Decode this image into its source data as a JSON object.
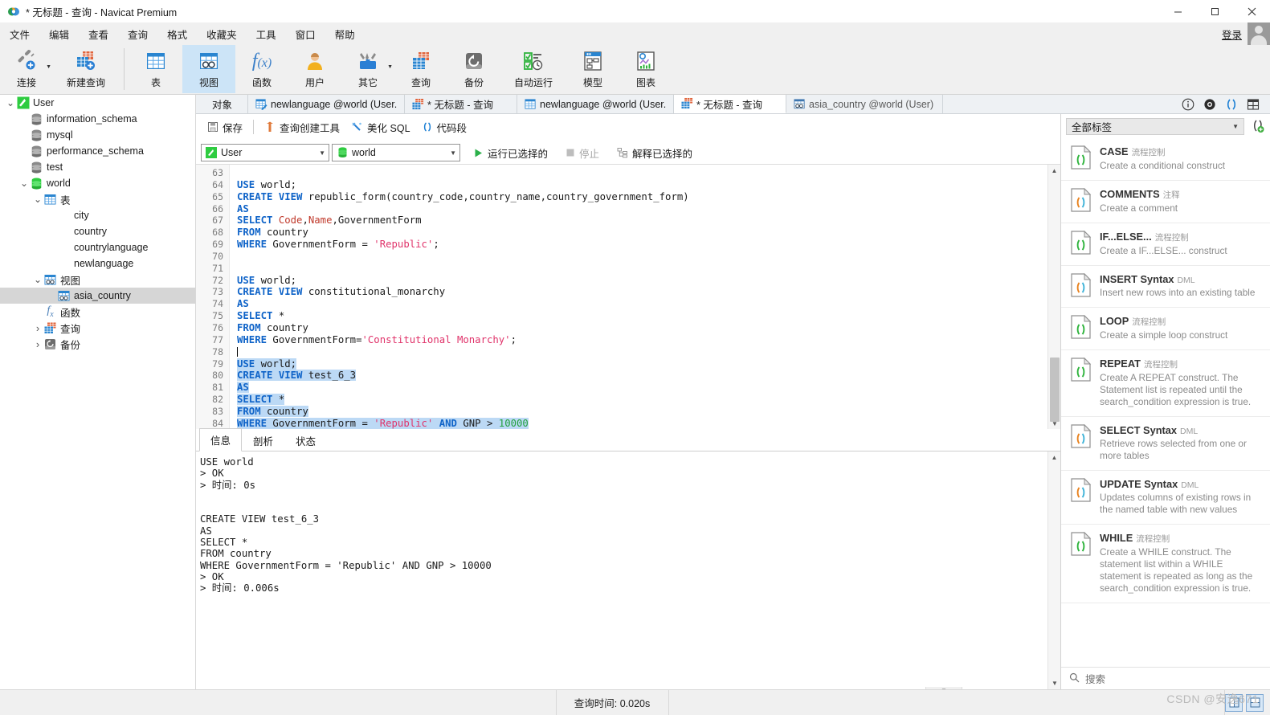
{
  "window": {
    "title": "* 无标题 - 查询 - Navicat Premium",
    "minimize": "—",
    "maximize": "□",
    "close": "✕"
  },
  "menubar": {
    "items": [
      "文件",
      "编辑",
      "查看",
      "查询",
      "格式",
      "收藏夹",
      "工具",
      "窗口",
      "帮助"
    ],
    "login_label": "登录"
  },
  "toolbar": {
    "items": [
      {
        "label": "连接",
        "icon": "connection-icon",
        "caret": true
      },
      {
        "label": "新建查询",
        "icon": "new-query-icon",
        "caret": false
      },
      {
        "label": "表",
        "icon": "table-icon",
        "caret": false
      },
      {
        "label": "视图",
        "icon": "view-icon",
        "caret": false,
        "active": true
      },
      {
        "label": "函数",
        "icon": "function-icon",
        "caret": false
      },
      {
        "label": "用户",
        "icon": "user-icon",
        "caret": false
      },
      {
        "label": "其它",
        "icon": "other-tools-icon",
        "caret": true
      },
      {
        "label": "查询",
        "icon": "query-icon",
        "caret": false
      },
      {
        "label": "备份",
        "icon": "backup-icon",
        "caret": false
      },
      {
        "label": "自动运行",
        "icon": "automation-icon",
        "caret": false
      },
      {
        "label": "模型",
        "icon": "model-icon",
        "caret": false
      },
      {
        "label": "图表",
        "icon": "chart-icon",
        "caret": false
      }
    ]
  },
  "tree": [
    {
      "label": "User",
      "icon": "navicat-connection-icon",
      "depth": 0,
      "twisty": "v",
      "selected": false
    },
    {
      "label": "information_schema",
      "icon": "database-icon",
      "depth": 1,
      "twisty": "",
      "selected": false
    },
    {
      "label": "mysql",
      "icon": "database-icon",
      "depth": 1,
      "twisty": "",
      "selected": false
    },
    {
      "label": "performance_schema",
      "icon": "database-icon",
      "depth": 1,
      "twisty": "",
      "selected": false
    },
    {
      "label": "test",
      "icon": "database-icon",
      "depth": 1,
      "twisty": "",
      "selected": false
    },
    {
      "label": "world",
      "icon": "database-open-icon",
      "depth": 1,
      "twisty": "v",
      "selected": false
    },
    {
      "label": "表",
      "icon": "table-folder-icon",
      "depth": 2,
      "twisty": "v",
      "selected": false
    },
    {
      "label": "city",
      "icon": "table-icon",
      "depth": 3,
      "twisty": "",
      "selected": false
    },
    {
      "label": "country",
      "icon": "table-icon",
      "depth": 3,
      "twisty": "",
      "selected": false
    },
    {
      "label": "countrylanguage",
      "icon": "table-icon",
      "depth": 3,
      "twisty": "",
      "selected": false
    },
    {
      "label": "newlanguage",
      "icon": "table-icon",
      "depth": 3,
      "twisty": "",
      "selected": false
    },
    {
      "label": "视图",
      "icon": "view-folder-icon",
      "depth": 2,
      "twisty": "v",
      "selected": false
    },
    {
      "label": "asia_country",
      "icon": "view-icon",
      "depth": 3,
      "twisty": "",
      "selected": true
    },
    {
      "label": "函数",
      "icon": "function-folder-icon",
      "depth": 2,
      "twisty": "",
      "selected": false
    },
    {
      "label": "查询",
      "icon": "query-folder-icon",
      "depth": 2,
      "twisty": ">",
      "selected": false
    },
    {
      "label": "备份",
      "icon": "backup-folder-icon",
      "depth": 2,
      "twisty": ">",
      "selected": false
    }
  ],
  "tabstrip": {
    "object_tab": "对象",
    "tabs": [
      {
        "label": "newlanguage @world (User...",
        "icon": "table-edit-icon",
        "active": false
      },
      {
        "label": "* 无标题 - 查询",
        "icon": "query-icon-small",
        "active": false
      },
      {
        "label": "newlanguage @world (User...",
        "icon": "table-icon",
        "active": false
      },
      {
        "label": "* 无标题 - 查询",
        "icon": "query-icon-small",
        "active": true
      },
      {
        "label": "asia_country @world (User) ...",
        "icon": "view-icon-small",
        "active": false
      }
    ],
    "right_icons": [
      "info-icon",
      "eye-icon",
      "parentheses-icon",
      "grid-icon"
    ]
  },
  "query_toolbar": {
    "save": "保存",
    "query_builder": "查询创建工具",
    "beautify_sql": "美化 SQL",
    "snippet": "代码段"
  },
  "conn_row": {
    "connection": "User",
    "database": "world",
    "run_selected": "运行已选择的",
    "stop": "停止",
    "explain_selected": "解释已选择的"
  },
  "editor": {
    "first_line": 63,
    "lines": [
      {
        "n": 63,
        "tokens": []
      },
      {
        "n": 64,
        "tokens": [
          {
            "t": "USE",
            "c": "kw"
          },
          {
            "t": " world;",
            "c": ""
          }
        ]
      },
      {
        "n": 65,
        "tokens": [
          {
            "t": "CREATE VIEW",
            "c": "kw"
          },
          {
            "t": " republic_form(country_code,country_name,country_government_form)",
            "c": ""
          }
        ]
      },
      {
        "n": 66,
        "tokens": [
          {
            "t": "AS",
            "c": "kw"
          }
        ]
      },
      {
        "n": 67,
        "tokens": [
          {
            "t": "SELECT",
            "c": "kw"
          },
          {
            "t": " ",
            "c": ""
          },
          {
            "t": "Code",
            "c": "fld"
          },
          {
            "t": ",",
            "c": ""
          },
          {
            "t": "Name",
            "c": "fld"
          },
          {
            "t": ",GovernmentForm",
            "c": ""
          }
        ]
      },
      {
        "n": 68,
        "tokens": [
          {
            "t": "FROM",
            "c": "kw"
          },
          {
            "t": " country",
            "c": ""
          }
        ]
      },
      {
        "n": 69,
        "tokens": [
          {
            "t": "WHERE",
            "c": "kw"
          },
          {
            "t": " GovernmentForm = ",
            "c": ""
          },
          {
            "t": "'Republic'",
            "c": "str"
          },
          {
            "t": ";",
            "c": ""
          }
        ]
      },
      {
        "n": 70,
        "tokens": []
      },
      {
        "n": 71,
        "tokens": []
      },
      {
        "n": 72,
        "tokens": [
          {
            "t": "USE",
            "c": "kw"
          },
          {
            "t": " world;",
            "c": ""
          }
        ]
      },
      {
        "n": 73,
        "tokens": [
          {
            "t": "CREATE VIEW",
            "c": "kw"
          },
          {
            "t": " constitutional_monarchy",
            "c": ""
          }
        ]
      },
      {
        "n": 74,
        "tokens": [
          {
            "t": "AS",
            "c": "kw"
          }
        ]
      },
      {
        "n": 75,
        "tokens": [
          {
            "t": "SELECT",
            "c": "kw"
          },
          {
            "t": " *",
            "c": ""
          }
        ]
      },
      {
        "n": 76,
        "tokens": [
          {
            "t": "FROM",
            "c": "kw"
          },
          {
            "t": " country",
            "c": ""
          }
        ]
      },
      {
        "n": 77,
        "tokens": [
          {
            "t": "WHERE",
            "c": "kw"
          },
          {
            "t": " GovernmentForm=",
            "c": ""
          },
          {
            "t": "'Constitutional Monarchy'",
            "c": "str"
          },
          {
            "t": ";",
            "c": ""
          }
        ]
      },
      {
        "n": 78,
        "tokens": [],
        "cursor": true
      },
      {
        "n": 79,
        "tokens": [
          {
            "t": "USE",
            "c": "kw"
          },
          {
            "t": " world;",
            "c": ""
          }
        ],
        "selected": true
      },
      {
        "n": 80,
        "tokens": [
          {
            "t": "CREATE VIEW",
            "c": "kw"
          },
          {
            "t": " test_6_3",
            "c": ""
          }
        ],
        "selected": true
      },
      {
        "n": 81,
        "tokens": [
          {
            "t": "AS",
            "c": "kw"
          }
        ],
        "selected": true
      },
      {
        "n": 82,
        "tokens": [
          {
            "t": "SELECT",
            "c": "kw"
          },
          {
            "t": " *",
            "c": ""
          }
        ],
        "selected": true
      },
      {
        "n": 83,
        "tokens": [
          {
            "t": "FROM",
            "c": "kw"
          },
          {
            "t": " country",
            "c": ""
          }
        ],
        "selected": true
      },
      {
        "n": 84,
        "tokens": [
          {
            "t": "WHERE",
            "c": "kw"
          },
          {
            "t": " GovernmentForm = ",
            "c": ""
          },
          {
            "t": "'Republic'",
            "c": "str"
          },
          {
            "t": " ",
            "c": ""
          },
          {
            "t": "AND",
            "c": "kw"
          },
          {
            "t": " GNP > ",
            "c": ""
          },
          {
            "t": "10000",
            "c": "num"
          }
        ],
        "selected": true
      }
    ]
  },
  "result": {
    "tabs": [
      {
        "label": "信息",
        "active": true
      },
      {
        "label": "剖析",
        "active": false
      },
      {
        "label": "状态",
        "active": false
      }
    ],
    "log_lines": [
      "USE world",
      "> OK",
      "> 时间: 0s",
      "",
      "",
      "CREATE VIEW test_6_3",
      "AS",
      "SELECT *",
      "FROM country",
      "WHERE GovernmentForm = 'Republic' AND GNP > 10000",
      "> OK",
      "> 时间: 0.006s"
    ]
  },
  "snippet_panel": {
    "filter_label": "全部标签",
    "add_icon": "add-snippet-icon",
    "search_placeholder": "搜索",
    "snippets": [
      {
        "title": "CASE",
        "category": "流程控制",
        "desc": "Create a conditional construct",
        "accent": "green"
      },
      {
        "title": "COMMENTS",
        "category": "注释",
        "desc": "Create a comment",
        "accent": "orange"
      },
      {
        "title": "IF...ELSE...",
        "category": "流程控制",
        "desc": "Create a IF...ELSE... construct",
        "accent": "green"
      },
      {
        "title": "INSERT Syntax",
        "category": "DML",
        "desc": "Insert new rows into an existing table",
        "accent": "orange"
      },
      {
        "title": "LOOP",
        "category": "流程控制",
        "desc": "Create a simple loop construct",
        "accent": "green"
      },
      {
        "title": "REPEAT",
        "category": "流程控制",
        "desc": "Create A REPEAT construct. The Statement list is repeated until the search_condition expression is true.",
        "accent": "green"
      },
      {
        "title": "SELECT Syntax",
        "category": "DML",
        "desc": "Retrieve rows selected from one or more tables",
        "accent": "orange"
      },
      {
        "title": "UPDATE Syntax",
        "category": "DML",
        "desc": "Updates columns of existing rows in the named table with new values",
        "accent": "orange"
      },
      {
        "title": "WHILE",
        "category": "流程控制",
        "desc": "Create a WHILE construct. The statement list within a WHILE statement is repeated as long as the search_condition expression is true.",
        "accent": "green"
      }
    ]
  },
  "statusbar": {
    "query_time_label": "查询时间: 0.020s",
    "watermark": "CSDN @安逸671"
  },
  "colors": {
    "accent_blue": "#0e63c8",
    "selection": "#bcd9f5",
    "string_red": "#e0336a",
    "number_green": "#22a13e",
    "active_tab_bg": "#cce4f7"
  }
}
